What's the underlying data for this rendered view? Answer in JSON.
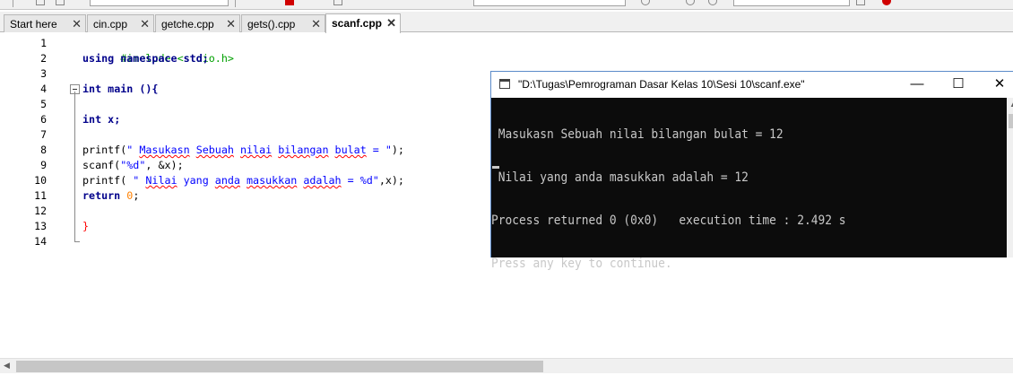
{
  "tabs": [
    {
      "label": "Start here",
      "active": false
    },
    {
      "label": "cin.cpp",
      "active": false
    },
    {
      "label": "getche.cpp",
      "active": false
    },
    {
      "label": "gets().cpp",
      "active": false
    },
    {
      "label": "scanf.cpp",
      "active": true
    }
  ],
  "editor": {
    "line_numbers": [
      "1",
      "2",
      "3",
      "4",
      "5",
      "6",
      "7",
      "8",
      "9",
      "10",
      "11",
      "12",
      "13",
      "14"
    ],
    "code": {
      "l1": "#include <stdio.h>",
      "l2_kw1": "using",
      "l2_kw2": "namespace",
      "l2_rest": " std;",
      "l4_kw": "int",
      "l4_rest": " main (){",
      "l6_kw": "int",
      "l6_rest": " x;",
      "l8_pre": "printf(",
      "l8_s1": "\" ",
      "l8_s2": "Masukasn",
      "l8_s3": " ",
      "l8_s4": "Sebuah",
      "l8_s5": " ",
      "l8_s6": "nilai",
      "l8_s7": " ",
      "l8_s8": "bilangan",
      "l8_s9": " ",
      "l8_s10": "bulat",
      "l8_s11": " = \"",
      "l8_post": ");",
      "l9_pre": "scanf(",
      "l9_str": "\"%d\"",
      "l9_post": ", &x);",
      "l10_pre": "printf( ",
      "l10_s1": "\" ",
      "l10_s2": "Nilai",
      "l10_s3": " yang ",
      "l10_s4": "anda",
      "l10_s5": " ",
      "l10_s6": "masukkan",
      "l10_s7": " ",
      "l10_s8": "adalah",
      "l10_s9": " = %d\"",
      "l10_post": ",x);",
      "l11_kw": "return",
      "l11_num": "0",
      "l11_post": ";",
      "l13": "}"
    }
  },
  "console": {
    "title": "\"D:\\Tugas\\Pemrograman Dasar Kelas 10\\Sesi 10\\scanf.exe\"",
    "lines": [
      " Masukasn Sebuah nilai bilangan bulat = 12",
      " Nilai yang anda masukkan adalah = 12",
      "Process returned 0 (0x0)   execution time : 2.492 s",
      "Press any key to continue."
    ],
    "minimize": "—",
    "maximize": "☐",
    "close": "✕"
  },
  "scroll": {
    "left_arrow": "◀",
    "right_arrow": "▶",
    "up_arrow": "▲"
  },
  "colors": {
    "preprocessor": "#00a000",
    "keyword": "#00008b",
    "string": "#0000ff",
    "number": "#ff8000",
    "console_bg": "#0c0c0c"
  }
}
